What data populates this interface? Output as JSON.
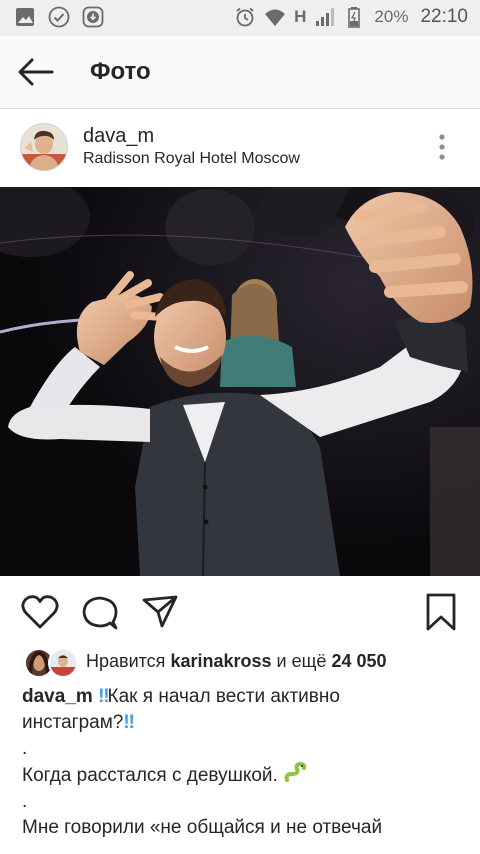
{
  "status_bar": {
    "network": "H",
    "battery": "20%",
    "time": "22:10"
  },
  "app_bar": {
    "title": "Фото"
  },
  "post": {
    "username": "dava_m",
    "location": "Radisson Royal Hotel Moscow"
  },
  "likes": {
    "prefix": "Нравится",
    "user": "karinakross",
    "middle": "и ещё",
    "count": "24 050"
  },
  "caption": {
    "username": "dava_m",
    "line1": "Как я начал вести активно",
    "line2": "инстаграм?",
    "dot1": ".",
    "line3": "Когда расстался с девушкой.",
    "dot2": ".",
    "line4": "Мне говорили «не общайся и не отвечай"
  },
  "colors": {
    "accent_emoji": "#3aa0e8",
    "statusbar_bg": "#efefef",
    "appbar_bg": "#fafafa"
  }
}
